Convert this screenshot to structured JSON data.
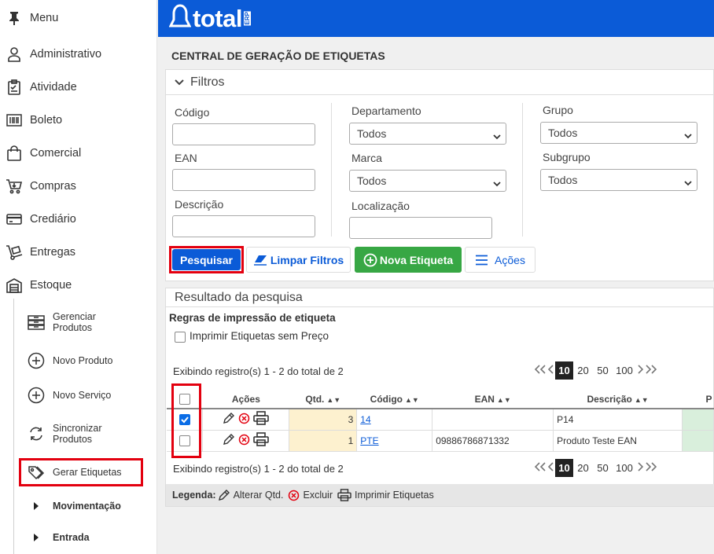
{
  "sidebar": {
    "menu_label": "Menu",
    "items": [
      {
        "label": "Administrativo",
        "icon": "user-admin-icon"
      },
      {
        "label": "Atividade",
        "icon": "clipboard-icon"
      },
      {
        "label": "Boleto",
        "icon": "barcode-icon"
      },
      {
        "label": "Comercial",
        "icon": "shopping-bag-icon"
      },
      {
        "label": "Compras",
        "icon": "cart-icon"
      },
      {
        "label": "Crediário",
        "icon": "credit-card-icon"
      },
      {
        "label": "Entregas",
        "icon": "hand-truck-icon"
      },
      {
        "label": "Estoque",
        "icon": "warehouse-icon"
      }
    ],
    "estoque_sub": [
      {
        "label": "Gerenciar\nProdutos"
      },
      {
        "label": "Novo Produto"
      },
      {
        "label": "Novo Serviço"
      },
      {
        "label": "Sincronizar\nProdutos"
      },
      {
        "label": "Gerar Etiquetas"
      },
      {
        "label": "Movimentação"
      },
      {
        "label": "Entrada"
      }
    ]
  },
  "header": {
    "logo_text": "total",
    "logo_sub": "ERP"
  },
  "page_title": "CENTRAL DE GERAÇÃO DE ETIQUETAS",
  "filters": {
    "title": "Filtros",
    "codigo_label": "Código",
    "ean_label": "EAN",
    "descricao_label": "Descrição",
    "departamento_label": "Departamento",
    "departamento_value": "Todos",
    "marca_label": "Marca",
    "marca_value": "Todos",
    "localizacao_label": "Localização",
    "grupo_label": "Grupo",
    "grupo_value": "Todos",
    "subgrupo_label": "Subgrupo",
    "subgrupo_value": "Todos"
  },
  "buttons": {
    "search": "Pesquisar",
    "clear": "Limpar Filtros",
    "new_label": "Nova Etiqueta",
    "actions": "Ações"
  },
  "results": {
    "title": "Resultado da pesquisa",
    "rules_title": "Regras de impressão de etiqueta",
    "print_without_price": "Imprimir Etiquetas sem Preço",
    "showing_top": "Exibindo registro(s) 1 - 2 do total de 2",
    "showing_bottom": "Exibindo registro(s) 1 - 2 do total de 2",
    "page_sizes": [
      "10",
      "20",
      "50",
      "100"
    ],
    "columns": [
      "Ações",
      "Qtd.",
      "Código",
      "EAN",
      "Descrição",
      "P"
    ],
    "rows": [
      {
        "checked": true,
        "qty": "3",
        "code": "14",
        "ean": "",
        "desc": "P14"
      },
      {
        "checked": false,
        "qty": "1",
        "code": "PTE",
        "ean": "09886786871332",
        "desc": "Produto Teste EAN"
      }
    ]
  },
  "legend": {
    "label": "Legenda:",
    "edit": "Alterar Qtd.",
    "delete": "Excluir",
    "print": "Imprimir Etiquetas"
  },
  "colors": {
    "brand_blue": "#0b5bd7",
    "green": "#37a744",
    "highlight_red": "#e3000f"
  }
}
